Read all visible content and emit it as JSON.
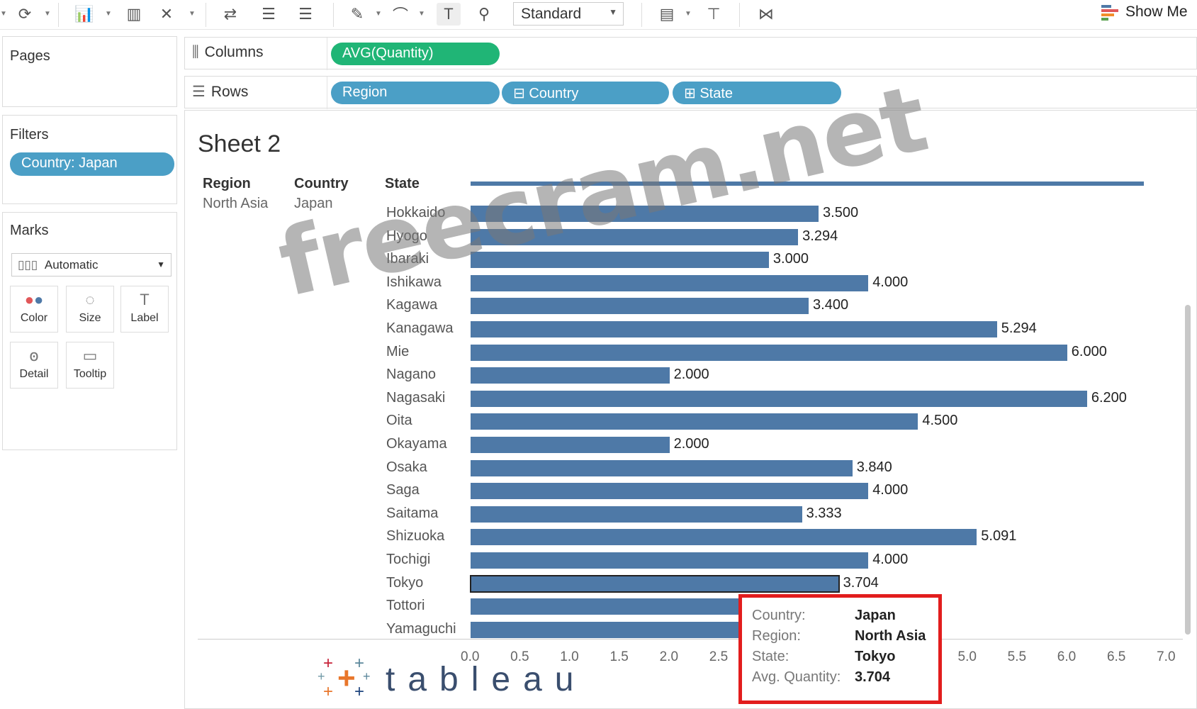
{
  "toolbar": {
    "standard_select": "Standard",
    "show_me": "Show Me"
  },
  "left": {
    "pages_title": "Pages",
    "filters_title": "Filters",
    "filter_pill": "Country: Japan",
    "marks_title": "Marks",
    "marks_type": "Automatic",
    "mark_buttons": [
      "Color",
      "Size",
      "Label",
      "Detail",
      "Tooltip"
    ]
  },
  "shelves": {
    "columns_label": "Columns",
    "rows_label": "Rows",
    "columns_pills": [
      "AVG(Quantity)"
    ],
    "rows_pills": [
      "Region",
      "Country",
      "State"
    ]
  },
  "sheet": {
    "title": "Sheet 2",
    "headers": [
      "Region",
      "Country",
      "State"
    ],
    "region_value": "North Asia",
    "country_value": "Japan"
  },
  "chart_data": {
    "type": "bar",
    "orientation": "horizontal",
    "categories": [
      "Hokkaido",
      "Hyogo",
      "Ibaraki",
      "Ishikawa",
      "Kagawa",
      "Kanagawa",
      "Mie",
      "Nagano",
      "Nagasaki",
      "Oita",
      "Okayama",
      "Osaka",
      "Saga",
      "Saitama",
      "Shizuoka",
      "Tochigi",
      "Tokyo",
      "Tottori",
      "Yamaguchi"
    ],
    "values": [
      3.5,
      3.294,
      3.0,
      4.0,
      3.4,
      5.294,
      6.0,
      2.0,
      6.2,
      4.5,
      2.0,
      3.84,
      4.0,
      3.333,
      5.091,
      4.0,
      3.704,
      2.9,
      3.0
    ],
    "labels": [
      "3.500",
      "3.294",
      "3.000",
      "4.000",
      "3.400",
      "5.294",
      "6.000",
      "2.000",
      "6.200",
      "4.500",
      "2.000",
      "3.840",
      "4.000",
      "3.333",
      "5.091",
      "4.000",
      "3.704",
      "",
      ""
    ],
    "selected": "Tokyo",
    "xlim": [
      0,
      7
    ],
    "xticks": [
      "0.0",
      "0.5",
      "1.0",
      "1.5",
      "2.0",
      "2.5",
      "5.0",
      "5.5",
      "6.0",
      "6.5",
      "7.0"
    ],
    "color": "#4e79a7"
  },
  "tooltip": {
    "rows": [
      {
        "k": "Country:",
        "v": "Japan"
      },
      {
        "k": "Region:",
        "v": "North Asia"
      },
      {
        "k": "State:",
        "v": "Tokyo"
      },
      {
        "k": "Avg. Quantity:",
        "v": "3.704"
      }
    ]
  },
  "watermark": "freecram.net",
  "logo": "tableau"
}
